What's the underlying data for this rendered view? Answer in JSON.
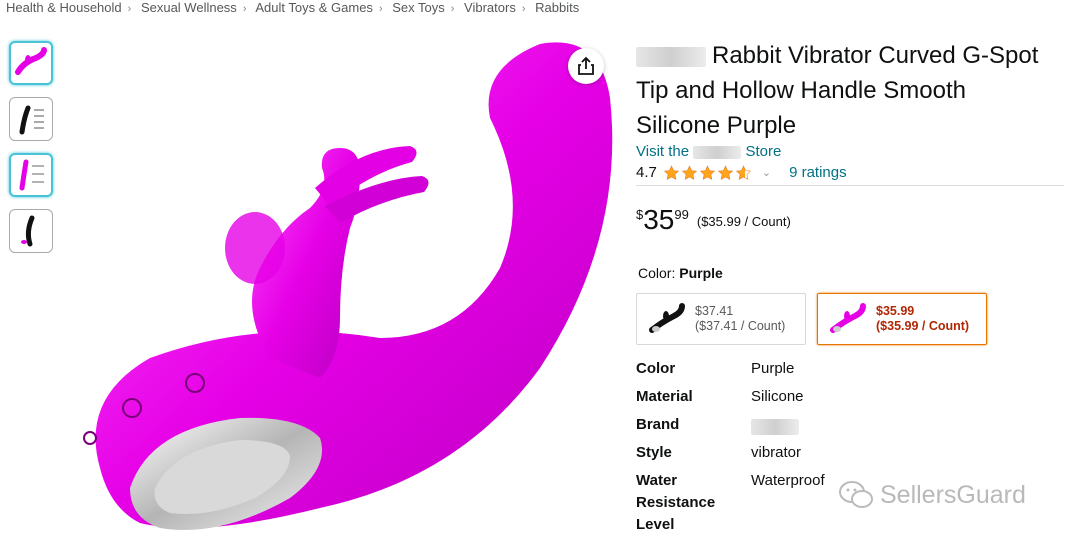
{
  "breadcrumb": [
    "Health & Household",
    "Sexual Wellness",
    "Adult Toys & Games",
    "Sex Toys",
    "Vibrators",
    "Rabbits"
  ],
  "product": {
    "title": "Rabbit Vibrator Curved G-Spot Tip and Hollow Handle Smooth Silicone Purple",
    "store_prefix": "Visit the",
    "store_suffix": "Store",
    "rating": "4.7",
    "rating_value": 4.7,
    "ratings_count": "9 ratings",
    "price": {
      "currency": "$",
      "whole": "35",
      "fraction": "99",
      "unit_price": "($35.99 / Count)"
    }
  },
  "color": {
    "label": "Color:",
    "selected": "Purple",
    "options": [
      {
        "price": "$37.41",
        "unit": "($37.41 / Count)",
        "icon": "black-rabbit-thumbnail",
        "selected": false
      },
      {
        "price": "$35.99",
        "unit": "($35.99 / Count)",
        "icon": "purple-rabbit-thumbnail",
        "selected": true
      }
    ]
  },
  "specs": [
    {
      "key": "Color",
      "value": "Purple"
    },
    {
      "key": "Material",
      "value": "Silicone"
    },
    {
      "key": "Brand",
      "value": ""
    },
    {
      "key": "Style",
      "value": "vibrator"
    },
    {
      "key": "Water Resistance Level",
      "value": "Waterproof"
    }
  ],
  "watermark": "SellersGuard",
  "colors": {
    "accent_link": "#007185",
    "star": "#ffa41c",
    "selected_border": "#e77600",
    "price_red": "#b12704",
    "product_magenta": "#e600e6"
  }
}
